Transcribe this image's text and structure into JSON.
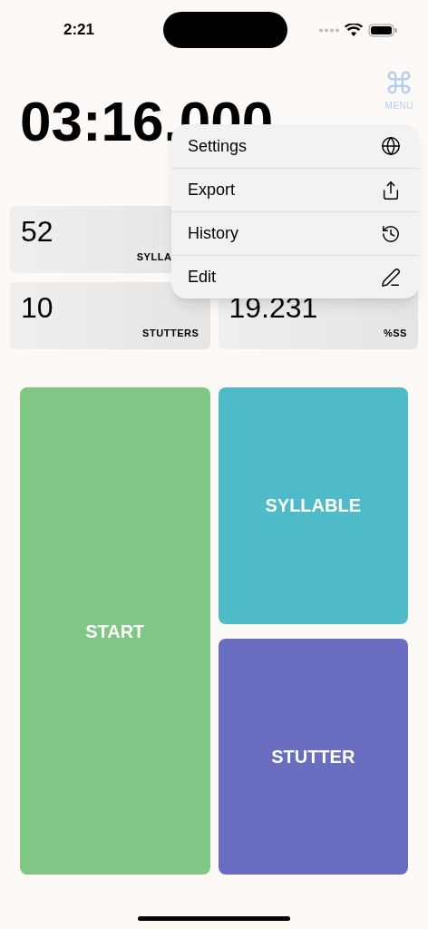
{
  "status_bar": {
    "time": "2:21"
  },
  "menu_button": {
    "label": "MENU"
  },
  "timer": "03:16.000",
  "stats": [
    {
      "value": "52",
      "label": "SYLLA"
    },
    {
      "value": "10",
      "label": "STUTTERS"
    },
    {
      "value": "19.231",
      "label": "%SS"
    }
  ],
  "menu": [
    {
      "label": "Settings",
      "kind": "globe"
    },
    {
      "label": "Export",
      "kind": "share"
    },
    {
      "label": "History",
      "kind": "history"
    },
    {
      "label": "Edit",
      "kind": "pencil"
    }
  ],
  "buttons": [
    {
      "label": "START",
      "color": "#80c684"
    },
    {
      "label": "SYLLABLE",
      "color": "#4fbac8"
    },
    {
      "label": "STUTTER",
      "color": "#6a6dc0"
    }
  ]
}
